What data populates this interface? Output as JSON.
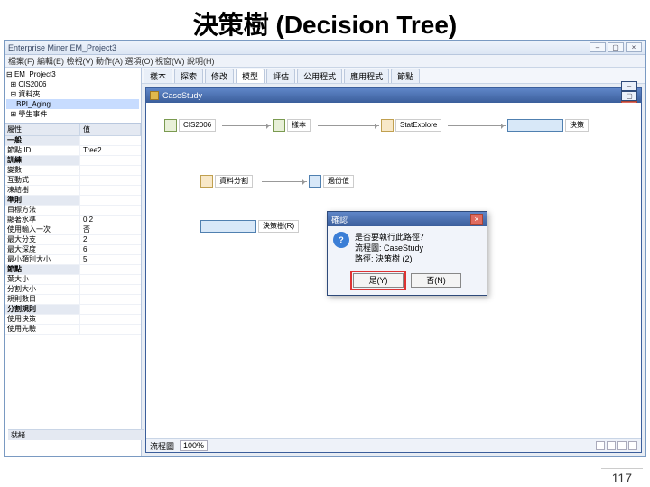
{
  "slide": {
    "title": "決策樹 (Decision Tree)",
    "page_number": "117"
  },
  "app": {
    "title": "Enterprise Miner  EM_Project3",
    "menu": "檔案(F) 編輯(E) 檢視(V) 動作(A) 選項(O) 視窗(W) 說明(H)"
  },
  "tree": {
    "items": [
      "EM_Project3",
      "CIS2006",
      "資料夾",
      "BPI_Aging",
      "學生事件"
    ],
    "selected_index": 3
  },
  "properties": {
    "header": {
      "c1": "屬性",
      "c2": "值"
    },
    "rows": [
      {
        "cat": true,
        "c1": "一般",
        "c2": ""
      },
      {
        "c1": "節點 ID",
        "c2": "Tree2"
      },
      {
        "cat": true,
        "c1": "訓練",
        "c2": ""
      },
      {
        "c1": "變數",
        "c2": ""
      },
      {
        "c1": "互動式",
        "c2": ""
      },
      {
        "c1": "凍結樹",
        "c2": ""
      },
      {
        "cat": true,
        "c1": "準則",
        "c2": ""
      },
      {
        "c1": "目標方法",
        "c2": ""
      },
      {
        "c1": "顯著水準",
        "c2": "0.2"
      },
      {
        "c1": "使用輸入一次",
        "c2": "否"
      },
      {
        "c1": "最大分支",
        "c2": "2"
      },
      {
        "c1": "最大深度",
        "c2": "6"
      },
      {
        "c1": "最小類別大小",
        "c2": "5"
      },
      {
        "cat": true,
        "c1": "節點",
        "c2": ""
      },
      {
        "c1": "葉大小",
        "c2": ""
      },
      {
        "c1": "分割大小",
        "c2": ""
      },
      {
        "c1": "規則數目",
        "c2": ""
      },
      {
        "cat": true,
        "c1": "分割規則",
        "c2": ""
      },
      {
        "c1": "使用決策",
        "c2": ""
      },
      {
        "c1": "使用先驗",
        "c2": ""
      }
    ]
  },
  "helpbar": "就緒",
  "tabs": [
    "樣本",
    "探索",
    "修改",
    "模型",
    "評估",
    "公用程式",
    "應用程式",
    "節點"
  ],
  "canvas": {
    "window_title": "CaseStudy",
    "nodes": {
      "data": {
        "label": "CIS2006"
      },
      "samp": {
        "label": "樣本"
      },
      "stat": {
        "label": "StatExplore"
      },
      "treeN": {
        "label": "決策"
      },
      "part": {
        "label": "資料分割"
      },
      "sel": {
        "label": "過份值"
      },
      "runmenu": {
        "label": "決策樹(R)"
      }
    },
    "statusbar": {
      "label": "流程圖",
      "mode": "100%"
    }
  },
  "dialog": {
    "title": "確認",
    "line1": "是否要執行此路徑？",
    "line2": "流程圖: CaseStudy",
    "line3": "路徑: 決策樹 (2)",
    "yes": "是(Y)",
    "no": "否(N)"
  }
}
